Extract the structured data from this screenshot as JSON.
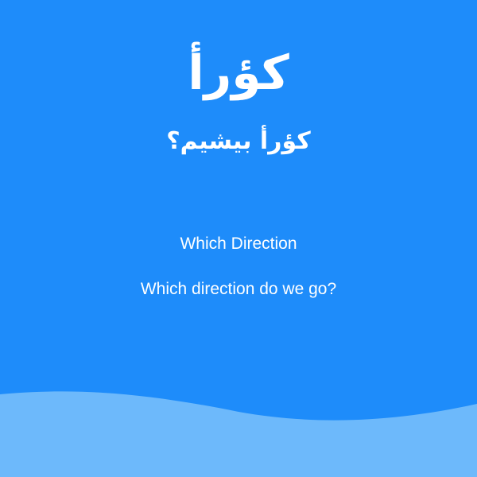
{
  "card": {
    "arabic_word": "كؤرأ",
    "arabic_phrase": "كؤرأ بيشيم؟",
    "english_word": "Which Direction",
    "english_phrase": "Which direction do we go?"
  },
  "colors": {
    "background": "#1e8cfa",
    "wave": "#6db9fb",
    "text": "#ffffff"
  }
}
